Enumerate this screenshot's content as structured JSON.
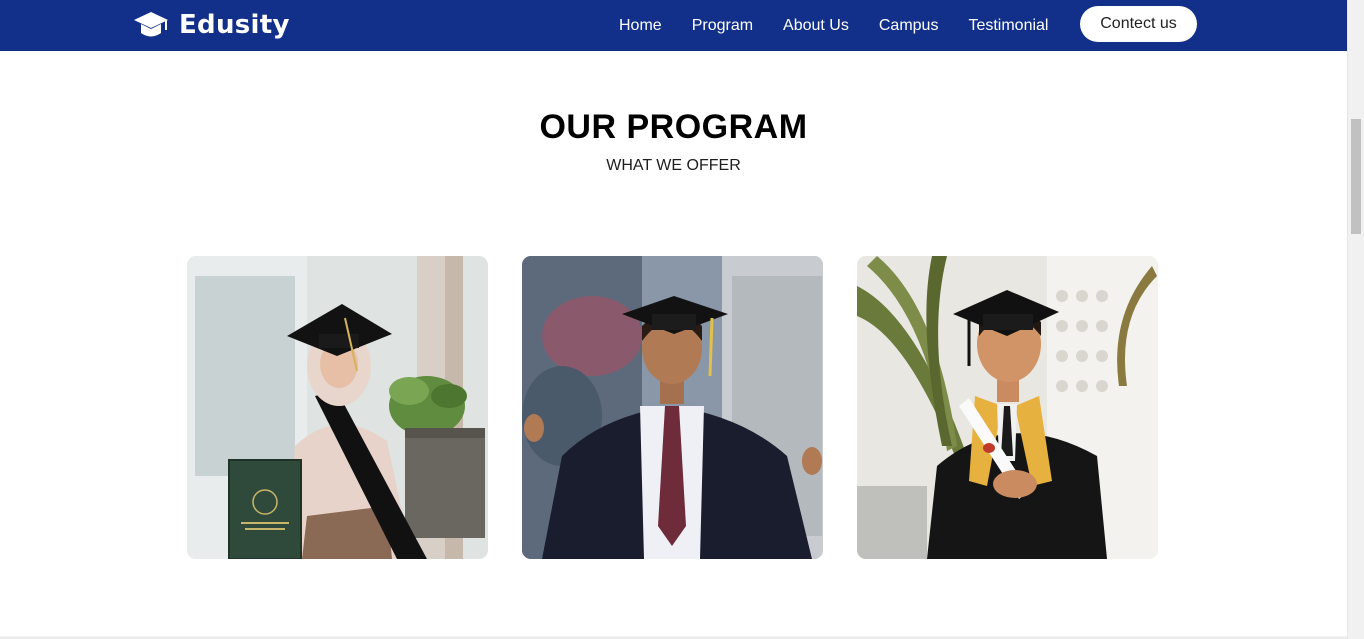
{
  "brand": {
    "name": "Edusity",
    "icon": "graduation-cap-icon"
  },
  "nav": {
    "items": [
      {
        "label": "Home"
      },
      {
        "label": "Program"
      },
      {
        "label": "About Us"
      },
      {
        "label": "Campus"
      },
      {
        "label": "Testimonial"
      }
    ],
    "cta_label": "Contect us"
  },
  "program": {
    "title": "OUR PROGRAM",
    "subtitle": "WHAT WE OFFER",
    "cards": [
      {
        "image": "graduate-woman-with-diploma-photo"
      },
      {
        "image": "graduate-man-smiling-photo"
      },
      {
        "image": "graduate-man-holding-diploma-photo"
      }
    ]
  },
  "colors": {
    "navbar": "#12308a",
    "button_bg": "#ffffff",
    "page_bg": "#ffffff",
    "title_text": "#000000"
  }
}
